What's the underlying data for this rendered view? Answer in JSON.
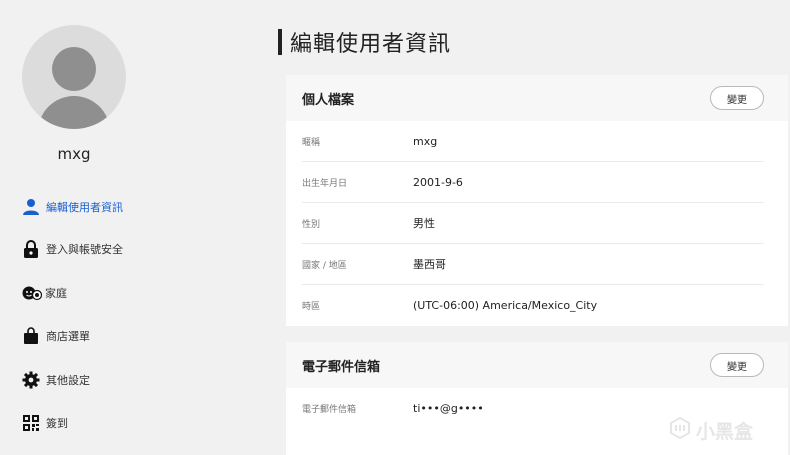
{
  "sidebar": {
    "username": "mxg",
    "items": [
      {
        "label": "編輯使用者資訊",
        "icon": "person-icon",
        "active": true
      },
      {
        "label": "登入與帳號安全",
        "icon": "lock-icon",
        "active": false
      },
      {
        "label": "家庭",
        "icon": "family-icon",
        "active": false
      },
      {
        "label": "商店選單",
        "icon": "shopping-bag-icon",
        "active": false
      },
      {
        "label": "其他設定",
        "icon": "gear-icon",
        "active": false
      },
      {
        "label": "簽到",
        "icon": "qr-code-icon",
        "active": false
      }
    ]
  },
  "main": {
    "title": "編輯使用者資訊",
    "profile": {
      "title": "個人檔案",
      "change_label": "變更",
      "rows": [
        {
          "key": "暱稱",
          "value": "mxg"
        },
        {
          "key": "出生年月日",
          "value": "2001-9-6"
        },
        {
          "key": "性別",
          "value": "男性"
        },
        {
          "key": "國家 / 地區",
          "value": "墨西哥"
        },
        {
          "key": "時區",
          "value": "(UTC-06:00) America/Mexico_City"
        }
      ]
    },
    "email": {
      "title": "電子郵件信箱",
      "change_label": "變更",
      "rows": [
        {
          "key": "電子郵件信箱",
          "value": "ti•••@g••••"
        }
      ]
    }
  },
  "watermark": {
    "text": "小黑盒"
  },
  "colors": {
    "accent": "#1a5fd0",
    "background": "#f1f1f1"
  }
}
